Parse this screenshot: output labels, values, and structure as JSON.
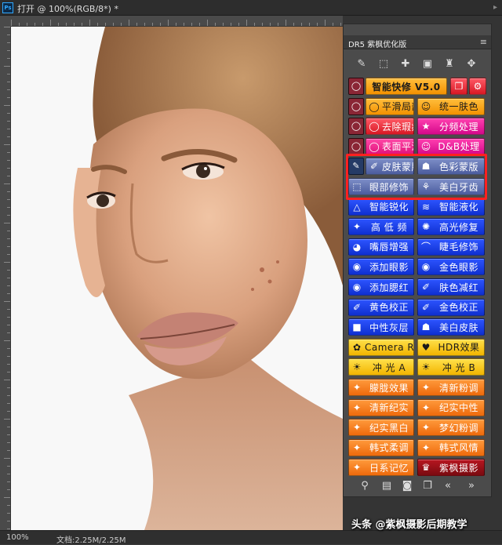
{
  "window": {
    "title": "打开 @ 100%(RGB/8*) *",
    "app_icon": "Ps",
    "controls": "▸"
  },
  "status": {
    "zoom": "100%",
    "doc_size": "文档:2.25M/2.25M"
  },
  "watermark": "头条 @紫枫摄影后期教学",
  "panel": {
    "title": "DR5 紫枫优化版",
    "collapse_glyph": "»",
    "close_glyph": "×",
    "menu_glyph": "≡",
    "tools": [
      {
        "icon": "brush-icon",
        "glyph": "✎"
      },
      {
        "icon": "eraser-icon",
        "glyph": "⬚"
      },
      {
        "icon": "bandage-icon",
        "glyph": "✚"
      },
      {
        "icon": "chip-icon",
        "glyph": "▣"
      },
      {
        "icon": "stamp-icon",
        "glyph": "♜"
      },
      {
        "icon": "clone-stamp-icon",
        "glyph": "✥"
      }
    ],
    "buttons": [
      {
        "label": "智能快修 V5.0",
        "color": "orange",
        "icon": "speech-bubble-icon"
      },
      {
        "label": "平滑局部",
        "color": "orange",
        "icon": "speech-bubble-icon"
      },
      {
        "label": "统一肤色",
        "color": "orange",
        "icon": "face-icon"
      },
      {
        "label": "去除瑕疵",
        "color": "red",
        "icon": "speech-bubble-icon"
      },
      {
        "label": "分频处理",
        "color": "magenta",
        "icon": "star-icon"
      },
      {
        "label": "表面平滑",
        "color": "pink",
        "icon": "speech-bubble-icon"
      },
      {
        "label": "D&B处理",
        "color": "magenta",
        "icon": "face-icon"
      },
      {
        "label": "皮肤蒙版",
        "color": "slate",
        "icon": "dropper-icon"
      },
      {
        "label": "色彩蒙版",
        "color": "slate",
        "icon": "mask-icon"
      },
      {
        "label": "眼部修饰",
        "color": "slate",
        "icon": "selection-icon"
      },
      {
        "label": "美白牙齿",
        "color": "slate",
        "icon": "tooth-icon"
      },
      {
        "label": "智能锐化",
        "color": "blue",
        "icon": "triangle-icon"
      },
      {
        "label": "智能液化",
        "color": "blue",
        "icon": "wave-icon"
      },
      {
        "label": "高 低 频",
        "color": "blue",
        "icon": "wand-icon"
      },
      {
        "label": "高光修复",
        "color": "blue",
        "icon": "sparkle-icon"
      },
      {
        "label": "嘴唇增强",
        "color": "blue",
        "icon": "lips-icon"
      },
      {
        "label": "睫毛修饰",
        "color": "blue",
        "icon": "eyelash-icon"
      },
      {
        "label": "添加眼影",
        "color": "blue",
        "icon": "eye-icon"
      },
      {
        "label": "金色眼影",
        "color": "blue",
        "icon": "eye-icon"
      },
      {
        "label": "添加腮红",
        "color": "blue",
        "icon": "eye-icon"
      },
      {
        "label": "肤色减红",
        "color": "blue",
        "icon": "dropper-icon"
      },
      {
        "label": "黄色校正",
        "color": "blue",
        "icon": "dropper-icon"
      },
      {
        "label": "金色校正",
        "color": "blue",
        "icon": "dropper-icon"
      },
      {
        "label": "中性灰层",
        "color": "blue",
        "icon": "square-icon"
      },
      {
        "label": "美白皮肤",
        "color": "blue",
        "icon": "mask-icon"
      },
      {
        "label": "Camera Raw",
        "color": "yellow",
        "icon": "flower-icon"
      },
      {
        "label": "HDR效果",
        "color": "yellow",
        "icon": "heart-icon"
      },
      {
        "label": "冲 光 A",
        "color": "yellow",
        "icon": "sun-icon"
      },
      {
        "label": "冲 光 B",
        "color": "yellow",
        "icon": "sun-icon"
      },
      {
        "label": "朦胧效果",
        "color": "oranged",
        "icon": "wand-icon"
      },
      {
        "label": "清新粉调",
        "color": "oranged",
        "icon": "wand-icon"
      },
      {
        "label": "清新纪实",
        "color": "oranged",
        "icon": "wand-icon"
      },
      {
        "label": "纪实中性",
        "color": "oranged",
        "icon": "wand-icon"
      },
      {
        "label": "纪实黑白",
        "color": "oranged",
        "icon": "wand-icon"
      },
      {
        "label": "梦幻粉调",
        "color": "oranged",
        "icon": "wand-icon"
      },
      {
        "label": "韩式柔调",
        "color": "oranged",
        "icon": "wand-icon"
      },
      {
        "label": "韩式风情",
        "color": "oranged",
        "icon": "wand-icon"
      },
      {
        "label": "日系记忆",
        "color": "oranged",
        "icon": "wand-icon"
      },
      {
        "label": "紫枫摄影",
        "color": "crimson",
        "icon": "logo-icon"
      }
    ],
    "footer": [
      {
        "icon": "search-icon",
        "glyph": "⚲"
      },
      {
        "icon": "book-icon",
        "glyph": "▤"
      },
      {
        "icon": "camera-icon",
        "glyph": "◙"
      },
      {
        "icon": "copy-icon",
        "glyph": "❐"
      },
      {
        "icon": "prev-icon",
        "glyph": "«"
      },
      {
        "icon": "next-icon",
        "glyph": "»"
      }
    ]
  },
  "colors": {
    "orange": "#f39100",
    "red": "#d81824",
    "magenta": "#d4088a",
    "slate": "#5a6bb0",
    "blue": "#1a3be8",
    "yellow": "#f2b400",
    "highlight": "#ff2020"
  }
}
